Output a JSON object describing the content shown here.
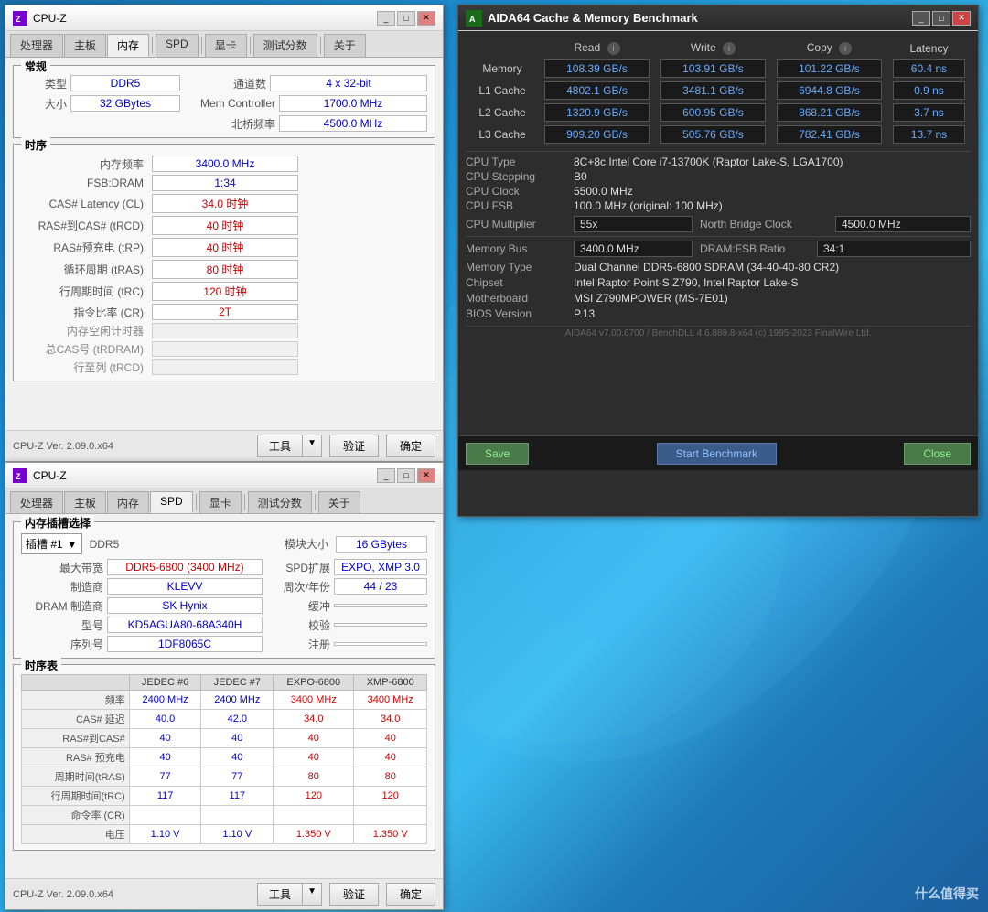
{
  "desktop": {
    "watermark": "什么值得买"
  },
  "cpuz1": {
    "title": "CPU-Z",
    "tabs": [
      "处理器",
      "主板",
      "内存",
      "SPD",
      "显卡",
      "测试分数",
      "关于"
    ],
    "active_tab": "内存",
    "section_general": "常规",
    "fields": {
      "type_label": "类型",
      "type_value": "DDR5",
      "channels_label": "通道数",
      "channels_value": "4 x 32-bit",
      "size_label": "大小",
      "size_value": "32 GBytes",
      "mem_controller_label": "Mem Controller",
      "mem_controller_value": "1700.0 MHz",
      "north_bridge_label": "北桥频率",
      "north_bridge_value": "4500.0 MHz"
    },
    "section_timings": "时序",
    "timings": {
      "freq_label": "内存频率",
      "freq_value": "3400.0 MHz",
      "fsb_dram_label": "FSB:DRAM",
      "fsb_dram_value": "1:34",
      "cas_label": "CAS# Latency (CL)",
      "cas_value": "34.0 时钟",
      "ras_rcd_label": "RAS#到CAS# (tRCD)",
      "ras_rcd_value": "40 时钟",
      "ras_rp_label": "RAS#预充电 (tRP)",
      "ras_rp_value": "40 时钟",
      "tras_label": "循环周期 (tRAS)",
      "tras_value": "80 时钟",
      "trc_label": "行周期时间 (tRC)",
      "trc_value": "120 时钟",
      "cr_label": "指令比率 (CR)",
      "cr_value": "2T",
      "idle_timer_label": "内存空闲计时器",
      "idle_timer_value": "",
      "total_cas_label": "总CAS号 (tRDRAM)",
      "total_cas_value": "",
      "row_cycle_label": "行至列 (tRCD)",
      "row_cycle_value": ""
    },
    "bottom": {
      "version": "CPU-Z  Ver. 2.09.0.x64",
      "tools": "工具",
      "validate": "验证",
      "ok": "确定"
    }
  },
  "cpuz2": {
    "title": "CPU-Z",
    "tabs": [
      "处理器",
      "主板",
      "内存",
      "SPD",
      "显卡",
      "测试分数",
      "关于"
    ],
    "active_tab": "SPD",
    "section_spd": "内存插槽选择",
    "spd": {
      "slot_label": "插槽 #1",
      "ddr_type": "DDR5",
      "module_size_label": "模块大小",
      "module_size_value": "16 GBytes",
      "max_bandwidth_label": "最大带宽",
      "max_bandwidth_value": "DDR5-6800 (3400 MHz)",
      "spd_ext_label": "SPD扩展",
      "spd_ext_value": "EXPO, XMP 3.0",
      "manufacturer_label": "制造商",
      "manufacturer_value": "KLEVV",
      "week_year_label": "周次/年份",
      "week_year_value": "44 / 23",
      "dram_mfr_label": "DRAM 制造商",
      "dram_mfr_value": "SK Hynix",
      "buffer_label": "缓冲",
      "buffer_value": "",
      "model_label": "型号",
      "model_value": "KD5AGUA80-68A340H",
      "checksum_label": "校验",
      "checksum_value": "",
      "serial_label": "序列号",
      "serial_value": "1DF8065C",
      "register_label": "注册",
      "register_value": ""
    },
    "section_timing": "时序表",
    "timing_table": {
      "headers": [
        "",
        "JEDEC #6",
        "JEDEC #7",
        "EXPO-6800",
        "XMP-6800"
      ],
      "rows": [
        {
          "label": "频率",
          "jedec6": "2400 MHz",
          "jedec7": "2400 MHz",
          "expo": "3400 MHz",
          "xmp": "3400 MHz"
        },
        {
          "label": "CAS# 延迟",
          "jedec6": "40.0",
          "jedec7": "42.0",
          "expo": "34.0",
          "xmp": "34.0"
        },
        {
          "label": "RAS#到CAS#",
          "jedec6": "40",
          "jedec7": "40",
          "expo": "40",
          "xmp": "40"
        },
        {
          "label": "RAS# 预充电",
          "jedec6": "40",
          "jedec7": "40",
          "expo": "40",
          "xmp": "40"
        },
        {
          "label": "周期时间(tRAS)",
          "jedec6": "77",
          "jedec7": "77",
          "expo": "80",
          "xmp": "80"
        },
        {
          "label": "行周期时间(tRC)",
          "jedec6": "117",
          "jedec7": "117",
          "expo": "120",
          "xmp": "120"
        },
        {
          "label": "命令率 (CR)",
          "jedec6": "",
          "jedec7": "",
          "expo": "",
          "xmp": ""
        },
        {
          "label": "电压",
          "jedec6": "1.10 V",
          "jedec7": "1.10 V",
          "expo": "1.350 V",
          "xmp": "1.350 V"
        }
      ]
    },
    "bottom": {
      "version": "CPU-Z  Ver. 2.09.0.x64",
      "tools": "工具",
      "validate": "验证",
      "ok": "确定"
    }
  },
  "aida64": {
    "title": "AIDA64 Cache & Memory Benchmark",
    "columns": {
      "read": "Read",
      "write": "Write",
      "copy": "Copy",
      "latency": "Latency"
    },
    "rows": [
      {
        "label": "Memory",
        "read": "108.39 GB/s",
        "write": "103.91 GB/s",
        "copy": "101.22 GB/s",
        "latency": "60.4 ns"
      },
      {
        "label": "L1 Cache",
        "read": "4802.1 GB/s",
        "write": "3481.1 GB/s",
        "copy": "6944.8 GB/s",
        "latency": "0.9 ns"
      },
      {
        "label": "L2 Cache",
        "read": "1320.9 GB/s",
        "write": "600.95 GB/s",
        "copy": "868.21 GB/s",
        "latency": "3.7 ns"
      },
      {
        "label": "L3 Cache",
        "read": "909.20 GB/s",
        "write": "505.76 GB/s",
        "copy": "782.41 GB/s",
        "latency": "13.7 ns"
      }
    ],
    "system_info": {
      "cpu_type_label": "CPU Type",
      "cpu_type_value": "8C+8c Intel Core i7-13700K  (Raptor Lake-S, LGA1700)",
      "cpu_stepping_label": "CPU Stepping",
      "cpu_stepping_value": "B0",
      "cpu_clock_label": "CPU Clock",
      "cpu_clock_value": "5500.0 MHz",
      "cpu_fsb_label": "CPU FSB",
      "cpu_fsb_value": "100.0 MHz  (original: 100 MHz)",
      "cpu_mult_label": "CPU Multiplier",
      "cpu_mult_value": "55x",
      "north_bridge_label": "North Bridge Clock",
      "north_bridge_value": "4500.0 MHz",
      "mem_bus_label": "Memory Bus",
      "mem_bus_value": "3400.0 MHz",
      "dram_fsb_label": "DRAM:FSB Ratio",
      "dram_fsb_value": "34:1",
      "mem_type_label": "Memory Type",
      "mem_type_value": "Dual Channel DDR5-6800 SDRAM  (34-40-40-80 CR2)",
      "chipset_label": "Chipset",
      "chipset_value": "Intel Raptor Point-S Z790, Intel Raptor Lake-S",
      "motherboard_label": "Motherboard",
      "motherboard_value": "MSI Z790MPOWER (MS-7E01)",
      "bios_label": "BIOS Version",
      "bios_value": "P.13"
    },
    "footer": "AIDA64 v7.00.6700 / BenchDLL 4.6.889.8-x64  (c) 1995-2023 FinalWire Ltd.",
    "buttons": {
      "save": "Save",
      "start": "Start Benchmark",
      "close": "Close"
    }
  }
}
